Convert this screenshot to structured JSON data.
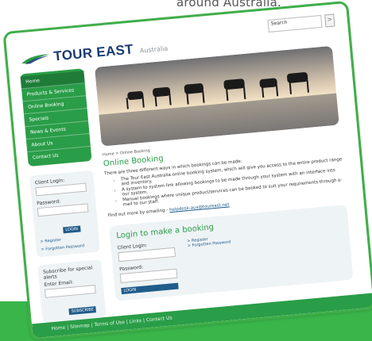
{
  "caption": "around Australia.",
  "site": {
    "brand": "TOUR EAST",
    "subtitle": "Australia",
    "search_value": "Search",
    "search_btn": ">"
  },
  "nav": {
    "items": [
      {
        "label": "Home"
      },
      {
        "label": "Products & Services"
      },
      {
        "label": "Online Booking"
      },
      {
        "label": "Specials"
      },
      {
        "label": "News & Events"
      },
      {
        "label": "About Us"
      },
      {
        "label": "Contact Us"
      }
    ]
  },
  "sidebar_login": {
    "client_login_label": "Client Login:",
    "password_label": "Password:",
    "login_btn": "LOGIN",
    "register_link": "> Register",
    "forgotten_link": "> Forgotten Password"
  },
  "subscribe": {
    "title": "Subscribe for special alerts",
    "email_label": "Enter Email:",
    "btn": "SUBSCRIBE"
  },
  "main": {
    "breadcrumb": "Home > Online Booking",
    "title": "Online Booking",
    "intro": "There are three different ways in which bookings can be made:",
    "bullets": [
      "The Tour East Australia online booking system, which will give you access to the entire product range and inventory.",
      "A system to system link allowing bookings to be made through your system with an interface into our system.",
      "Manual bookings where unique product/services can be booked to suit your requirements through e-mail to our staff."
    ],
    "find_more": "Find out more by emailing - ",
    "email": "helpdesk-aus@toureast.net"
  },
  "booking": {
    "title": "Login to make a booking",
    "client_login_label": "Client Login:",
    "password_label": "Password:",
    "login_btn": "LOGIN",
    "register_link": "> Register",
    "forgotten_link": "> Forgotten Password"
  },
  "footer": {
    "links_text": "Home | Sitemap | Terms of Use | Links | Contact Us"
  },
  "colors": {
    "accent_green": "#2a9d48",
    "frame_green": "#3fae49",
    "panel_green": "#39b54a",
    "navy": "#1a3b73"
  }
}
